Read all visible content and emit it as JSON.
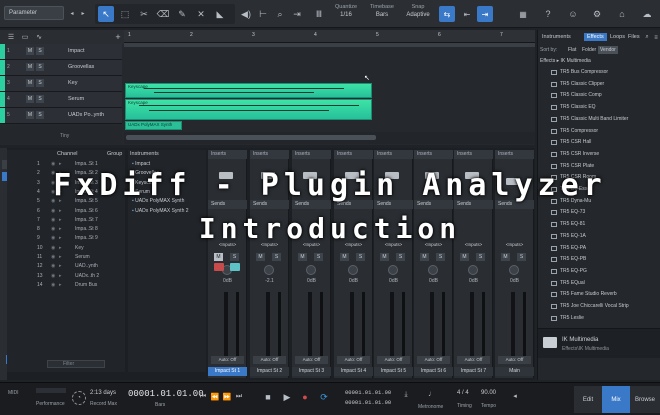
{
  "toolbar": {
    "parameter_label": "Parameter",
    "quantize_label": "Quantize",
    "quantize_value": "1/16",
    "timebase_label": "Timebase",
    "timebase_value": "Bars",
    "snap_label": "Snap",
    "snap_value": "Adaptive"
  },
  "ruler": [
    "1",
    "2",
    "3",
    "4",
    "5",
    "6",
    "7"
  ],
  "tracks": [
    {
      "num": "1",
      "name": "Impact"
    },
    {
      "num": "2",
      "name": "Groovellas"
    },
    {
      "num": "3",
      "name": "Key"
    },
    {
      "num": "4",
      "name": "Serum"
    },
    {
      "num": "5",
      "name": "UADx Po..ynth"
    }
  ],
  "track_footer": "Tiny",
  "clips": [
    "Keyscape",
    "Keyscape",
    "UADx PolyMAX Synth"
  ],
  "channel_list": {
    "header_channel": "Channel",
    "header_group": "Group",
    "rows": [
      {
        "num": "1",
        "name": "Impa..St 1"
      },
      {
        "num": "2",
        "name": "Impa..St 2"
      },
      {
        "num": "3",
        "name": "Impa..St 3"
      },
      {
        "num": "4",
        "name": "Impa..St 4"
      },
      {
        "num": "5",
        "name": "Impa..St 5"
      },
      {
        "num": "6",
        "name": "Impa..St 6"
      },
      {
        "num": "7",
        "name": "Impa..St 7"
      },
      {
        "num": "8",
        "name": "Impa..St 8"
      },
      {
        "num": "9",
        "name": "Impa..St 9"
      },
      {
        "num": "10",
        "name": "Key"
      },
      {
        "num": "11",
        "name": "Serum"
      },
      {
        "num": "12",
        "name": "UAD..ynth"
      },
      {
        "num": "13",
        "name": "UADx..th 2"
      },
      {
        "num": "14",
        "name": "Drum Bus"
      }
    ],
    "filter_placeholder": "Filter"
  },
  "instruments": {
    "header": "Instruments",
    "items": [
      "Impact",
      "Groovellas",
      "Keyscape",
      "Serum",
      "UADx PolyMAX Synth",
      "UADx PolyMAX Synth 2"
    ]
  },
  "strips": [
    {
      "name": "Impact St 1",
      "db": "0dB",
      "auto": "Auto: Off"
    },
    {
      "name": "Impact St 2",
      "db": "-2.1",
      "auto": "Auto: Off"
    },
    {
      "name": "Impact St 3",
      "db": "0dB",
      "auto": "Auto: Off"
    },
    {
      "name": "Impact St 4",
      "db": "0dB",
      "auto": "Auto: Off"
    },
    {
      "name": "Impact St 5",
      "db": "0dB",
      "auto": "Auto: Off"
    },
    {
      "name": "Impact St 6",
      "db": "0dB",
      "auto": "Auto: Off"
    },
    {
      "name": "Impact St 7",
      "db": "0dB",
      "auto": "Auto: Off"
    },
    {
      "name": "Main",
      "db": "0dB",
      "auto": "Auto: Off"
    }
  ],
  "strip_labels": {
    "inserts": "Inserts",
    "sends": "Sends",
    "inputs": "<Inputs>",
    "m": "M",
    "s": "S"
  },
  "browser": {
    "tabs": [
      "Instruments",
      "Effects",
      "Loops",
      "Files"
    ],
    "sort_label": "Sort by:",
    "sort_options": [
      "Flat",
      "Folder",
      "Vendor"
    ],
    "path": [
      "Effects",
      "IK Multimedia"
    ],
    "plugins": [
      "TR5 Bus Compressor",
      "TR5 Classic Clipper",
      "TR5 Classic Comp",
      "TR5 Classic EQ",
      "TR5 Classic Multi Band Limiter",
      "TR5 Compressor",
      "TR5 CSR Hall",
      "TR5 CSR Inverse",
      "TR5 CSR Plate",
      "TR5 CSR Room",
      "TR5 De-Esser",
      "TR5 Dyna-Mu",
      "TR5 EQ-73",
      "TR5 EQ-81",
      "TR5 EQ-1A",
      "TR5 EQ-PA",
      "TR5 EQ-PB",
      "TR5 EQ-PG",
      "TR5 EQual",
      "TR5 Fame Studio Reverb",
      "TR5 Joe Chiccarelli Vocal Strip",
      "TR5 Leslie"
    ],
    "footer_title": "IK Multimedia",
    "footer_path": "Effects\\IK Multimedia"
  },
  "transport": {
    "midi_label": "MIDI",
    "performance_label": "Performance",
    "days": "2:13 days",
    "record_max": "Record Max",
    "position": "00001.01.01.00",
    "position_unit": "Bars",
    "loop_start": "00001.01.01.00",
    "loop_end": "00001.01.01.00",
    "metronome": "Metronome",
    "timing_value": "4 / 4",
    "timing_label": "Timing",
    "tempo_value": "90.00",
    "tempo_label": "Tempo",
    "tabs": [
      "Edit",
      "Mix",
      "Browse"
    ]
  },
  "overlay": {
    "line1": "FxDiff - Plugin Analyzer",
    "line2": "Introduction"
  }
}
